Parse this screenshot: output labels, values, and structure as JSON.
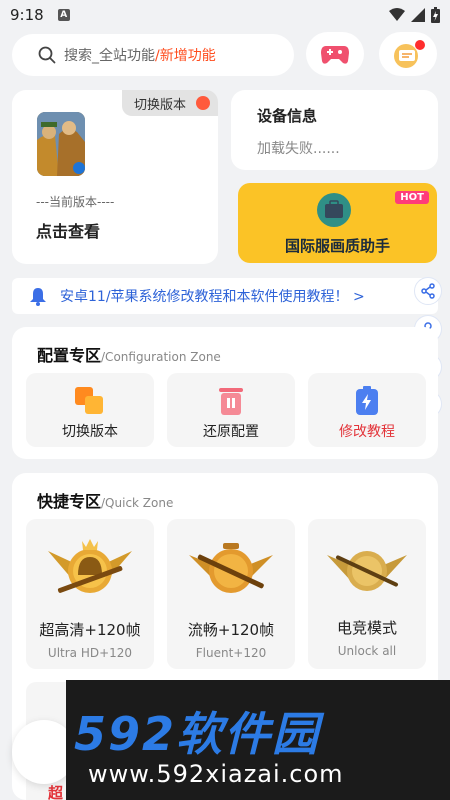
{
  "status": {
    "time": "9:18",
    "a_icon": "A"
  },
  "search": {
    "placeholder_1": "搜索_全站功能",
    "placeholder_2": "/新增功能"
  },
  "version_card": {
    "switch_label": "切换版本",
    "current_label": "---当前版本----",
    "view_label": "点击查看"
  },
  "device_card": {
    "title": "设备信息",
    "status": "加载失败......"
  },
  "hot_card": {
    "badge": "HOT",
    "label": "国际服画质助手"
  },
  "notice": {
    "text": "安卓11/苹果系统修改教程和本软件使用教程！ >"
  },
  "config_zone": {
    "title": "配置专区",
    "subtitle": "/Configuration Zone",
    "items": [
      {
        "label": "切换版本"
      },
      {
        "label": "还原配置"
      },
      {
        "label": "修改教程"
      }
    ]
  },
  "quick_zone": {
    "title": "快捷专区",
    "subtitle": "/Quick Zone",
    "items": [
      {
        "label": "超高清+120帧",
        "sublabel": "Ultra HD+120"
      },
      {
        "label": "流畅+120帧",
        "sublabel": "Fluent+120"
      },
      {
        "label": "电竞模式",
        "sublabel": "Unlock all"
      }
    ],
    "partial_label": "超"
  },
  "watermark": {
    "logo": "592软件园",
    "url": "www.592xiazai.com"
  },
  "colors": {
    "accent_red": "#ff4d1f",
    "hot_yellow": "#fbc326",
    "link_blue": "#2e63d8",
    "config_red": "#e3343a"
  }
}
